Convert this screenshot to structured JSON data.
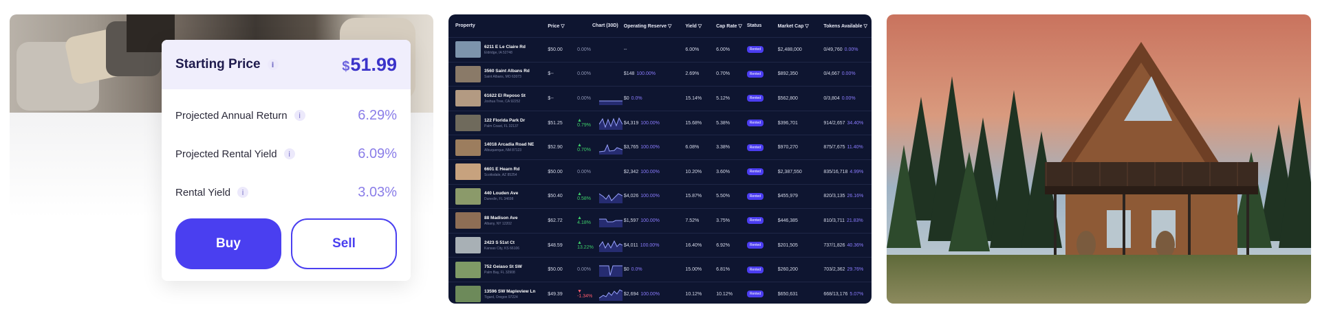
{
  "card": {
    "title": "Starting Price",
    "info_glyph": "i",
    "currency": "$",
    "price": "51.99",
    "stats": [
      {
        "label": "Projected Annual Return",
        "value": "6.29%"
      },
      {
        "label": "Projected Rental Yield",
        "value": "6.09%"
      },
      {
        "label": "Rental Yield",
        "value": "3.03%"
      }
    ],
    "buy_label": "Buy",
    "sell_label": "Sell"
  },
  "table": {
    "headers": {
      "property": "Property",
      "price": "Price ▽",
      "chart": "Chart (30D)",
      "reserve": "Operating Reserve ▽",
      "yield": "Yield ▽",
      "cap": "Cap Rate ▽",
      "status": "Status",
      "mcap": "Market Cap ▽",
      "tokens": "Tokens Available ▽"
    },
    "rows": [
      {
        "name": "6211 E Le Claire Rd",
        "addr": "Eldridge, IA 52748",
        "price": "$50.00",
        "chg": "0.00%",
        "dir": "flat",
        "reserve": "--",
        "reserve_pct": "",
        "yield": "6.00%",
        "cap": "6.00%",
        "status": "Rented",
        "mcap": "$2,488,000",
        "tokens": "0/49,760",
        "tokens_pct": "0.00%",
        "thumb": "#7d94ac"
      },
      {
        "name": "3560 Saint Albans Rd",
        "addr": "Saint Albans, MO 63073",
        "price": "$--",
        "chg": "0.00%",
        "dir": "flat",
        "reserve": "$148",
        "reserve_pct": "100.00%",
        "yield": "2.69%",
        "cap": "0.70%",
        "status": "Rented",
        "mcap": "$892,350",
        "tokens": "0/4,667",
        "tokens_pct": "0.00%",
        "thumb": "#8a7a68"
      },
      {
        "name": "61622 El Reposo St",
        "addr": "Joshua Tree, CA 92252",
        "price": "$--",
        "chg": "0.00%",
        "dir": "flat",
        "reserve": "$0",
        "reserve_pct": "0.0%",
        "yield": "15.14%",
        "cap": "5.12%",
        "status": "Rented",
        "mcap": "$562,800",
        "tokens": "0/3,804",
        "tokens_pct": "0.00%",
        "thumb": "#b39a82"
      },
      {
        "name": "122 Florida Park Dr",
        "addr": "Palm Coast, FL 32137",
        "price": "$51.25",
        "chg": "0.79%",
        "dir": "up",
        "reserve": "$4,319",
        "reserve_pct": "100.00%",
        "yield": "15.68%",
        "cap": "5.38%",
        "status": "Rented",
        "mcap": "$396,701",
        "tokens": "914/2,657",
        "tokens_pct": "34.40%",
        "thumb": "#6f6a5c"
      },
      {
        "name": "14018 Arcadia Road NE",
        "addr": "Albuquerque, NM 87123",
        "price": "$52.90",
        "chg": "0.70%",
        "dir": "up",
        "reserve": "$3,765",
        "reserve_pct": "100.00%",
        "yield": "6.08%",
        "cap": "3.38%",
        "status": "Rented",
        "mcap": "$970,270",
        "tokens": "875/7,675",
        "tokens_pct": "11.40%",
        "thumb": "#9c7d5e"
      },
      {
        "name": "6601 E Hearn Rd",
        "addr": "Scottsdale, AZ 85254",
        "price": "$50.00",
        "chg": "0.00%",
        "dir": "flat",
        "reserve": "$2,342",
        "reserve_pct": "100.00%",
        "yield": "10.20%",
        "cap": "3.60%",
        "status": "Rented",
        "mcap": "$2,387,550",
        "tokens": "835/16,718",
        "tokens_pct": "4.99%",
        "thumb": "#c7a27e"
      },
      {
        "name": "440 Louden Ave",
        "addr": "Dunedin, FL 34698",
        "price": "$50.40",
        "chg": "0.58%",
        "dir": "up",
        "reserve": "$4,026",
        "reserve_pct": "100.00%",
        "yield": "15.87%",
        "cap": "5.50%",
        "status": "Rented",
        "mcap": "$455,979",
        "tokens": "820/3,135",
        "tokens_pct": "26.16%",
        "thumb": "#8b9a6a"
      },
      {
        "name": "88 Madison Ave",
        "addr": "Albany, NY 12202",
        "price": "$62.72",
        "chg": "4.18%",
        "dir": "up",
        "reserve": "$1,597",
        "reserve_pct": "100.00%",
        "yield": "7.52%",
        "cap": "3.75%",
        "status": "Rented",
        "mcap": "$446,385",
        "tokens": "810/3,711",
        "tokens_pct": "21.83%",
        "thumb": "#8e6e55"
      },
      {
        "name": "2423 S 51st Ct",
        "addr": "Kansas City, KS 66106",
        "price": "$48.59",
        "chg": "13.22%",
        "dir": "up",
        "reserve": "$4,011",
        "reserve_pct": "100.00%",
        "yield": "16.40%",
        "cap": "6.92%",
        "status": "Rented",
        "mcap": "$201,505",
        "tokens": "737/1,826",
        "tokens_pct": "40.36%",
        "thumb": "#a8b0b5"
      },
      {
        "name": "752 Geiaso St SW",
        "addr": "Palm Bay, FL 32908",
        "price": "$50.00",
        "chg": "0.00%",
        "dir": "flat",
        "reserve": "$0",
        "reserve_pct": "0.0%",
        "yield": "15.00%",
        "cap": "6.81%",
        "status": "Rented",
        "mcap": "$260,200",
        "tokens": "703/2,362",
        "tokens_pct": "29.76%",
        "thumb": "#7f9a66"
      },
      {
        "name": "13596 SW Mapleview Ln",
        "addr": "Tigard, Oregon 97224",
        "price": "$49.39",
        "chg": "-1.34%",
        "dir": "down",
        "reserve": "$2,694",
        "reserve_pct": "100.00%",
        "yield": "10.12%",
        "cap": "10.12%",
        "status": "Rented",
        "mcap": "$650,631",
        "tokens": "668/13,176",
        "tokens_pct": "5.07%",
        "thumb": "#6d8a5a"
      }
    ]
  },
  "colors": {
    "accent": "#4a3ff0",
    "table_bg": "#0e1530",
    "up": "#3ecf6a",
    "down": "#ff5b6b"
  },
  "icons": {
    "info": "info-icon",
    "up": "triangle-up-icon",
    "down": "triangle-down-icon",
    "sort": "sort-triangle-icon"
  }
}
